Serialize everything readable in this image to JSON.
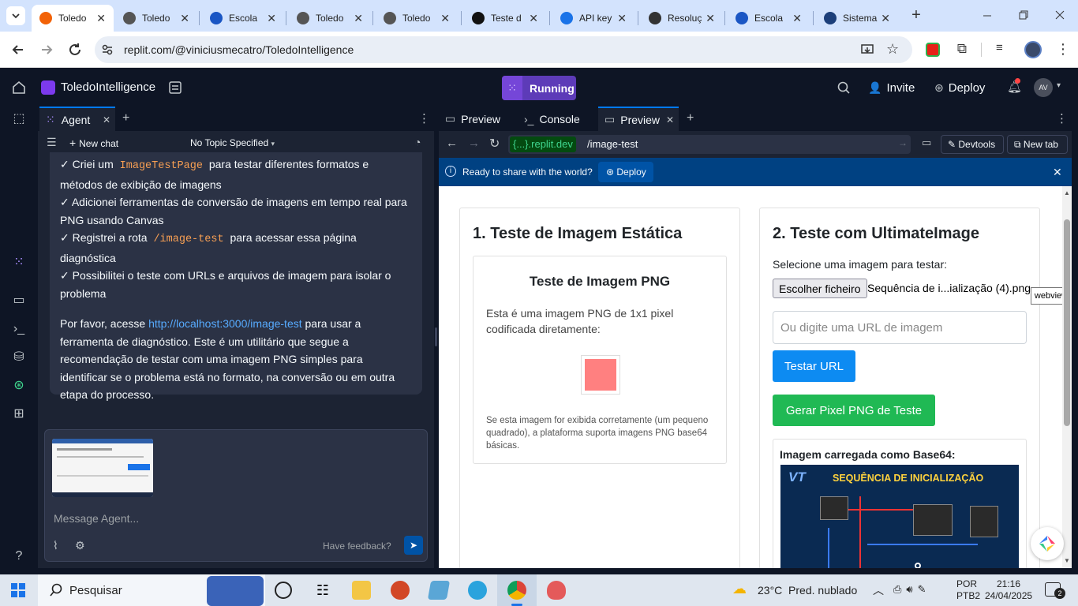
{
  "browser": {
    "tabs": [
      {
        "title": "Toledo",
        "active": true,
        "fav_color": "#f26207"
      },
      {
        "title": "Toledo",
        "active": false,
        "fav_color": "#555555"
      },
      {
        "title": "Escola",
        "active": false,
        "fav_color": "#1a56c4"
      },
      {
        "title": "Toledo",
        "active": false,
        "fav_color": "#555555"
      },
      {
        "title": "Toledo",
        "active": false,
        "fav_color": "#555555"
      },
      {
        "title": "Teste d",
        "active": false,
        "fav_color": "#111111"
      },
      {
        "title": "API key",
        "active": false,
        "fav_color": "#1a73e8"
      },
      {
        "title": "Resoluç",
        "active": false,
        "fav_color": "#333333"
      },
      {
        "title": "Escola",
        "active": false,
        "fav_color": "#1a56c4"
      },
      {
        "title": "Sistema",
        "active": false,
        "fav_color": "#1c3f7a"
      }
    ],
    "url": "replit.com/@viniciusmecatro/ToledoIntelligence"
  },
  "replit": {
    "project_name": "ToledoIntelligence",
    "run_status": "Running",
    "invite_label": "Invite",
    "deploy_label": "Deploy",
    "avatar_initials": "AV"
  },
  "agent": {
    "tab_label": "Agent",
    "new_chat": "New chat",
    "topic": "No Topic Specified",
    "message": {
      "line1_pre": "✓ Criei um ",
      "line1_code": "ImageTestPage",
      "line1_post": " para testar diferentes formatos e métodos de exibição de imagens",
      "line2": "✓ Adicionei ferramentas de conversão de imagens em tempo real para PNG usando Canvas",
      "line3_pre": "✓ Registrei a rota ",
      "line3_code": "/image-test",
      "line3_post": " para acessar essa página diagnóstica",
      "line4": "✓ Possibilitei o teste com URLs e arquivos de imagem para isolar o problema",
      "para_pre": "Por favor, acesse ",
      "para_link": "http://localhost:3000/image-test",
      "para_post": " para usar a ferramenta de diagnóstico. Este é um utilitário que segue a recomendação de testar com uma imagem PNG simples para identificar se o problema está no formato, na conversão ou em outra etapa do processo."
    },
    "input_placeholder": "Message Agent...",
    "feedback": "Have feedback?"
  },
  "preview": {
    "tabs": [
      "Preview",
      "Console",
      "Preview"
    ],
    "domain": "{...}.replit.dev",
    "path": "/image-test",
    "devtools": "Devtools",
    "new_tab": "New tab",
    "banner_text": "Ready to share with the world?",
    "banner_button": "Deploy",
    "tooltip": "webview"
  },
  "page": {
    "section1_title": "1. Teste de Imagem Estática",
    "png_card_title": "Teste de Imagem PNG",
    "png_desc": "Esta é uma imagem PNG de 1x1 pixel codificada diretamente:",
    "png_note": "Se esta imagem for exibida corretamente (um pequeno quadrado), a plataforma suporta imagens PNG base64 básicas.",
    "pixel_color": "#ff8080",
    "section2_title": "2. Teste com UltimateImage",
    "select_label": "Selecione uma imagem para testar:",
    "file_button": "Escolher ficheiro",
    "file_name": "Sequência de i...ialização (4).png",
    "url_placeholder": "Ou digite uma URL de imagem",
    "test_url_button": "Testar URL",
    "gen_button": "Gerar Pixel PNG de Teste",
    "base64_label": "Imagem carregada como Base64:",
    "image_logo": "VT",
    "image_heading": "SEQUÊNCIA DE INICIALIZAÇÃO"
  },
  "taskbar": {
    "search": "Pesquisar",
    "weather": "23°C  Pred. nublado",
    "lang1": "POR",
    "lang2": "PTB2",
    "time": "21:16",
    "date": "24/04/2025",
    "notif_count": "2"
  }
}
